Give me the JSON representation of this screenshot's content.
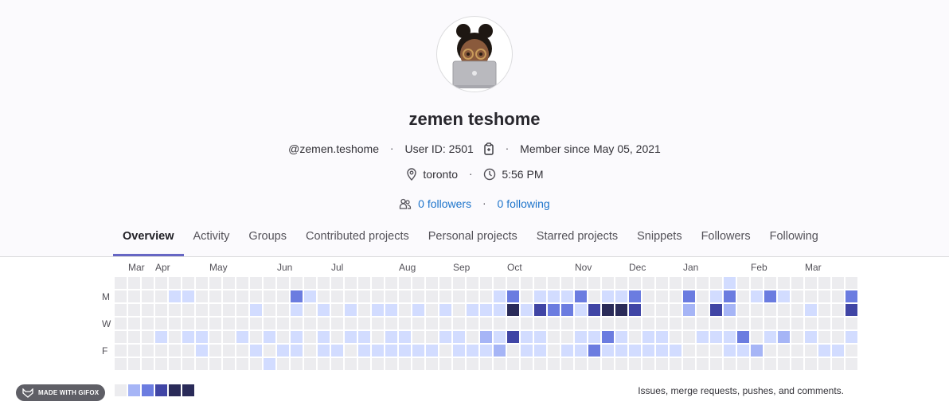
{
  "profile": {
    "name": "zemen teshome",
    "username": "@zemen.teshome",
    "user_id_label": "User ID: 2501",
    "member_since": "Member since May 05, 2021",
    "location": "toronto",
    "local_time": "5:56 PM",
    "followers_label": "0 followers",
    "following_label": "0 following",
    "separator": "·"
  },
  "tabs": [
    {
      "label": "Overview",
      "active": true
    },
    {
      "label": "Activity"
    },
    {
      "label": "Groups"
    },
    {
      "label": "Contributed projects"
    },
    {
      "label": "Personal projects"
    },
    {
      "label": "Starred projects"
    },
    {
      "label": "Snippets"
    },
    {
      "label": "Followers"
    },
    {
      "label": "Following"
    }
  ],
  "calendar": {
    "months": [
      "Mar",
      "Apr",
      "May",
      "Jun",
      "Jul",
      "Aug",
      "Sep",
      "Oct",
      "Nov",
      "Dec",
      "Jan",
      "Feb",
      "Mar"
    ],
    "month_start_weeks": [
      1,
      3,
      7,
      12,
      16,
      21,
      25,
      29,
      34,
      38,
      42,
      47,
      51
    ],
    "day_labels": [
      "M",
      "W",
      "F"
    ],
    "colors": [
      "#ececef",
      "#d2dcff",
      "#a6b5f6",
      "#6b7ce0",
      "#4045a5",
      "#2a2b59"
    ],
    "levels": [
      "0000000000000000000000000000000000000000000001000000000",
      "0000110000000310000000000000130111301130003013013100003",
      "0000000000100101010110101011151433145540002042000001004",
      "0000000000000000000000000000000000000000000000000000000",
      "0001011001010101011011001102141100113101100111301201001",
      "0000001000101101101111110111201101131111110001120000110",
      "0000000000010000000000000000000000000000000000000000000"
    ],
    "fix_note": ""
  },
  "legend": {
    "caption": "Issues, merge requests, pushes, and comments."
  },
  "badge": {
    "label": "MADE WITH GIFOX"
  }
}
